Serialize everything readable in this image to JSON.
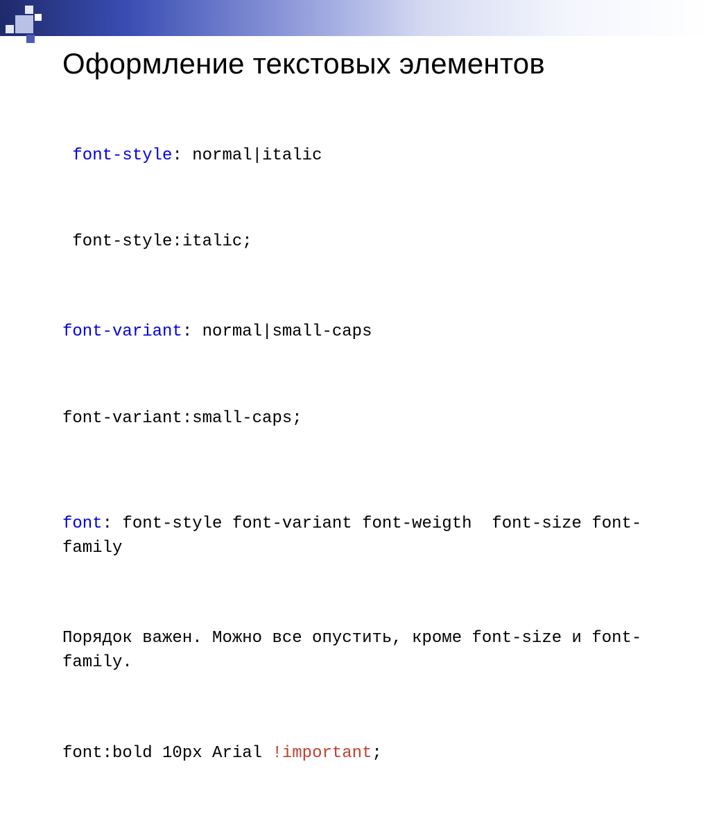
{
  "title": "Оформление текстовых элементов",
  "lines": {
    "l1a": "font-style",
    "l1b": ": normal|italic",
    "l2": " font-style:italic;",
    "l3a": "font-variant",
    "l3b": ": normal|small-caps",
    "l4": "font-variant:small-caps;",
    "l5a": "font",
    "l5b": ": font-style font-variant font-weigth  font-size font-family",
    "l6": "Порядок важен. Можно все опустить, кроме font-size и font-family.",
    "l7a": "font:bold 10px Arial ",
    "l7b": "!important",
    "l7c": ";"
  }
}
